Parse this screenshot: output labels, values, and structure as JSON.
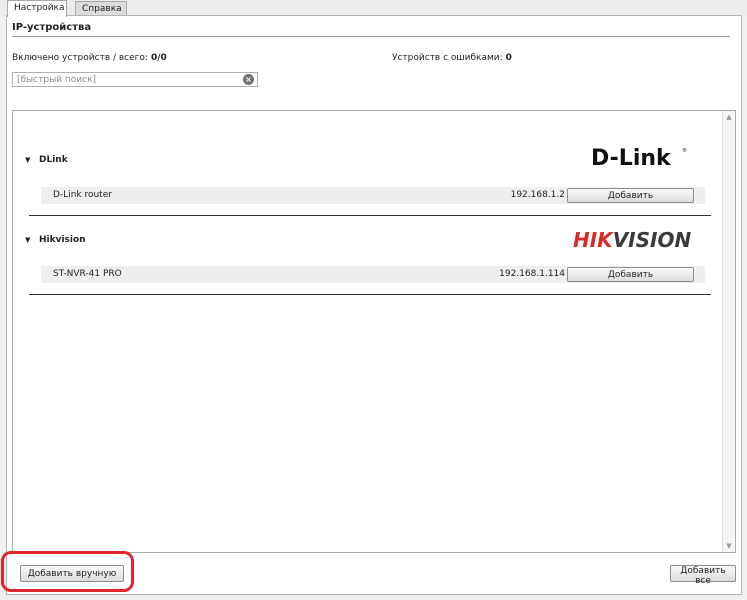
{
  "tabs": [
    {
      "label": "Настройка",
      "active": true
    },
    {
      "label": "Справка",
      "active": false
    }
  ],
  "section": {
    "title": "IP-устройства"
  },
  "stats": {
    "enabled_label": "Включено устройств / всего:",
    "enabled_value": "0/0",
    "errors_label": "Устройств с ошибками:",
    "errors_value": "0"
  },
  "search": {
    "placeholder": "[быстрый поиск]",
    "value": "",
    "clear_icon": "clear-icon"
  },
  "groups": [
    {
      "name": "DLink",
      "logo_text": "D-Link",
      "expanded": true,
      "devices": [
        {
          "name": "D-Link router",
          "ip": "192.168.1.2",
          "button": "Добавить"
        }
      ]
    },
    {
      "name": "Hikvision",
      "logo_text": "HIKVISION",
      "expanded": true,
      "devices": [
        {
          "name": "ST-NVR-41 PRO",
          "ip": "192.168.1.114",
          "button": "Добавить"
        }
      ]
    }
  ],
  "buttons": {
    "add_manual": "Добавить вручную",
    "add_all": "Добавить все"
  },
  "colors": {
    "highlight": "#e0262d",
    "hik_red": "#d52b2b"
  }
}
